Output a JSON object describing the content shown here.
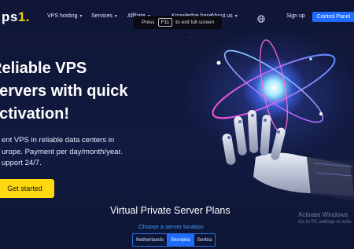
{
  "nav": {
    "logo_prefix": "ps",
    "logo_suffix": "1.",
    "items": [
      {
        "label": "VPS hosting",
        "has_caret": true
      },
      {
        "label": "Services",
        "has_caret": true
      },
      {
        "label": "Affiliate",
        "has_caret": true
      },
      {
        "label": "Knowledge base",
        "has_caret": false
      },
      {
        "label": "About us",
        "has_caret": true
      }
    ],
    "globe_icon": "globe-icon",
    "signup_label": "Sign up",
    "control_panel_label": "Control Panel",
    "caret_glyph": "▾"
  },
  "toast": {
    "prefix": "Press",
    "key": "F11",
    "suffix": "to exit full screen"
  },
  "hero": {
    "title_line1": "Reliable VPS",
    "title_line2": "servers with quick",
    "title_line3": "activation!",
    "desc_line1": "ent VPS in reliable data centers in",
    "desc_line2": "urope. Payment per day/month/year.",
    "desc_line3": "upport 24/7.",
    "cta_label": "Get started",
    "illustration_icon": "robot-hand-atom-illustration"
  },
  "plans": {
    "title": "Virtual Private Server Plans",
    "location_label": "Choose a server location",
    "locations": [
      {
        "label": "Netherlands",
        "active": false
      },
      {
        "label": "Slovakia",
        "active": true
      },
      {
        "label": "Serbia",
        "active": false
      }
    ]
  },
  "watermark": {
    "line1": "Activate Windows",
    "line2": "Go to PC settings to activ"
  },
  "colors": {
    "background": "#0f1636",
    "accent_blue": "#1e6bff",
    "accent_yellow": "#ffd80f",
    "link_blue": "#3ea0ff"
  }
}
